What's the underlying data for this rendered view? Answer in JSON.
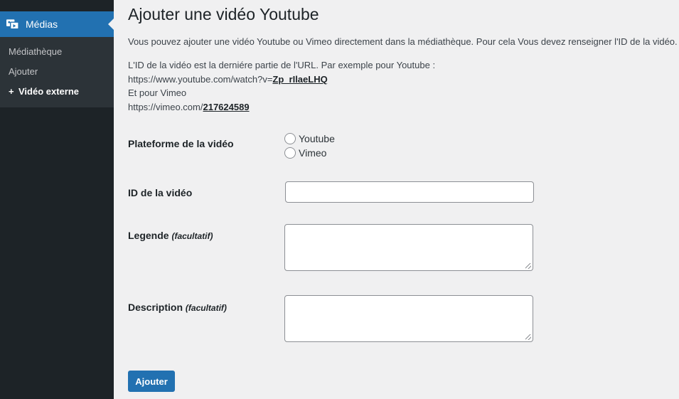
{
  "sidebar": {
    "menu_label": "Médias",
    "items": [
      {
        "label": "Médiathèque"
      },
      {
        "label": "Ajouter"
      },
      {
        "label": "Vidéo externe",
        "prefix": "+"
      }
    ]
  },
  "page": {
    "title": "Ajouter une vidéo Youtube",
    "intro": "Vous pouvez ajouter une vidéo Youtube ou Vimeo directement dans la médiathèque. Pour cela Vous devez renseigner l'ID de la vidéo.",
    "help_line1": "L'ID de la vidéo est la derniére partie de l'URL. Par exemple pour Youtube :",
    "help_yt_prefix": "https://www.youtube.com/watch?v=",
    "help_yt_id": "Zp_rIlaeLHQ",
    "help_line3": "Et pour Vimeo",
    "help_vimeo_prefix": "https://vimeo.com/",
    "help_vimeo_id": "217624589"
  },
  "form": {
    "platform_label": "Plateforme de la vidéo",
    "platform_options": [
      "Youtube",
      "Vimeo"
    ],
    "id_label": "ID de la vidéo",
    "id_value": "",
    "legend_label": "Legende",
    "legend_optional": "(facultatif)",
    "description_label": "Description",
    "description_optional": "(facultatif)",
    "submit_label": "Ajouter"
  }
}
